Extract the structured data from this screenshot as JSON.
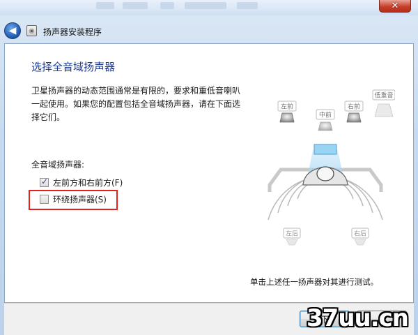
{
  "window": {
    "title": "扬声器安装程序",
    "close_glyph": "✕",
    "back_glyph": "◀"
  },
  "page": {
    "heading": "选择全音域扬声器",
    "description": "卫星扬声器的动态范围通常是有限的，要求和重低音喇叭一起使用。如果您的配置包括全音域扬声器，请在下面选择它们。",
    "group_label": "全音域扬声器:",
    "options": [
      {
        "label": "左前方和右前方(F)",
        "checked": true
      },
      {
        "label": "环绕扬声器(S)",
        "checked": false
      }
    ],
    "test_hint": "单击上述任一扬声器对其进行测试。"
  },
  "speakers": {
    "front_left": "左前",
    "center": "中前",
    "front_right": "右前",
    "subwoofer": "低重音",
    "rear_left": "左后",
    "rear_right": "右后"
  },
  "buttons": {
    "next": "下",
    "cancel": ""
  },
  "watermark": "37uu.cn",
  "colors": {
    "heading": "#1c3a99",
    "highlight": "#e0221f",
    "accent_blue": "#2461b8"
  }
}
